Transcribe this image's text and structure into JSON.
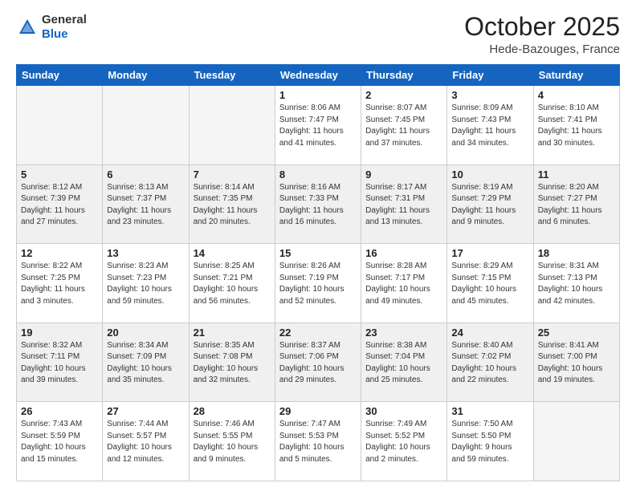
{
  "header": {
    "logo_line1": "General",
    "logo_line2": "Blue",
    "month": "October 2025",
    "location": "Hede-Bazouges, France"
  },
  "days_of_week": [
    "Sunday",
    "Monday",
    "Tuesday",
    "Wednesday",
    "Thursday",
    "Friday",
    "Saturday"
  ],
  "weeks": [
    {
      "shaded": false,
      "days": [
        {
          "num": "",
          "info": ""
        },
        {
          "num": "",
          "info": ""
        },
        {
          "num": "",
          "info": ""
        },
        {
          "num": "1",
          "info": "Sunrise: 8:06 AM\nSunset: 7:47 PM\nDaylight: 11 hours\nand 41 minutes."
        },
        {
          "num": "2",
          "info": "Sunrise: 8:07 AM\nSunset: 7:45 PM\nDaylight: 11 hours\nand 37 minutes."
        },
        {
          "num": "3",
          "info": "Sunrise: 8:09 AM\nSunset: 7:43 PM\nDaylight: 11 hours\nand 34 minutes."
        },
        {
          "num": "4",
          "info": "Sunrise: 8:10 AM\nSunset: 7:41 PM\nDaylight: 11 hours\nand 30 minutes."
        }
      ]
    },
    {
      "shaded": true,
      "days": [
        {
          "num": "5",
          "info": "Sunrise: 8:12 AM\nSunset: 7:39 PM\nDaylight: 11 hours\nand 27 minutes."
        },
        {
          "num": "6",
          "info": "Sunrise: 8:13 AM\nSunset: 7:37 PM\nDaylight: 11 hours\nand 23 minutes."
        },
        {
          "num": "7",
          "info": "Sunrise: 8:14 AM\nSunset: 7:35 PM\nDaylight: 11 hours\nand 20 minutes."
        },
        {
          "num": "8",
          "info": "Sunrise: 8:16 AM\nSunset: 7:33 PM\nDaylight: 11 hours\nand 16 minutes."
        },
        {
          "num": "9",
          "info": "Sunrise: 8:17 AM\nSunset: 7:31 PM\nDaylight: 11 hours\nand 13 minutes."
        },
        {
          "num": "10",
          "info": "Sunrise: 8:19 AM\nSunset: 7:29 PM\nDaylight: 11 hours\nand 9 minutes."
        },
        {
          "num": "11",
          "info": "Sunrise: 8:20 AM\nSunset: 7:27 PM\nDaylight: 11 hours\nand 6 minutes."
        }
      ]
    },
    {
      "shaded": false,
      "days": [
        {
          "num": "12",
          "info": "Sunrise: 8:22 AM\nSunset: 7:25 PM\nDaylight: 11 hours\nand 3 minutes."
        },
        {
          "num": "13",
          "info": "Sunrise: 8:23 AM\nSunset: 7:23 PM\nDaylight: 10 hours\nand 59 minutes."
        },
        {
          "num": "14",
          "info": "Sunrise: 8:25 AM\nSunset: 7:21 PM\nDaylight: 10 hours\nand 56 minutes."
        },
        {
          "num": "15",
          "info": "Sunrise: 8:26 AM\nSunset: 7:19 PM\nDaylight: 10 hours\nand 52 minutes."
        },
        {
          "num": "16",
          "info": "Sunrise: 8:28 AM\nSunset: 7:17 PM\nDaylight: 10 hours\nand 49 minutes."
        },
        {
          "num": "17",
          "info": "Sunrise: 8:29 AM\nSunset: 7:15 PM\nDaylight: 10 hours\nand 45 minutes."
        },
        {
          "num": "18",
          "info": "Sunrise: 8:31 AM\nSunset: 7:13 PM\nDaylight: 10 hours\nand 42 minutes."
        }
      ]
    },
    {
      "shaded": true,
      "days": [
        {
          "num": "19",
          "info": "Sunrise: 8:32 AM\nSunset: 7:11 PM\nDaylight: 10 hours\nand 39 minutes."
        },
        {
          "num": "20",
          "info": "Sunrise: 8:34 AM\nSunset: 7:09 PM\nDaylight: 10 hours\nand 35 minutes."
        },
        {
          "num": "21",
          "info": "Sunrise: 8:35 AM\nSunset: 7:08 PM\nDaylight: 10 hours\nand 32 minutes."
        },
        {
          "num": "22",
          "info": "Sunrise: 8:37 AM\nSunset: 7:06 PM\nDaylight: 10 hours\nand 29 minutes."
        },
        {
          "num": "23",
          "info": "Sunrise: 8:38 AM\nSunset: 7:04 PM\nDaylight: 10 hours\nand 25 minutes."
        },
        {
          "num": "24",
          "info": "Sunrise: 8:40 AM\nSunset: 7:02 PM\nDaylight: 10 hours\nand 22 minutes."
        },
        {
          "num": "25",
          "info": "Sunrise: 8:41 AM\nSunset: 7:00 PM\nDaylight: 10 hours\nand 19 minutes."
        }
      ]
    },
    {
      "shaded": false,
      "days": [
        {
          "num": "26",
          "info": "Sunrise: 7:43 AM\nSunset: 5:59 PM\nDaylight: 10 hours\nand 15 minutes."
        },
        {
          "num": "27",
          "info": "Sunrise: 7:44 AM\nSunset: 5:57 PM\nDaylight: 10 hours\nand 12 minutes."
        },
        {
          "num": "28",
          "info": "Sunrise: 7:46 AM\nSunset: 5:55 PM\nDaylight: 10 hours\nand 9 minutes."
        },
        {
          "num": "29",
          "info": "Sunrise: 7:47 AM\nSunset: 5:53 PM\nDaylight: 10 hours\nand 5 minutes."
        },
        {
          "num": "30",
          "info": "Sunrise: 7:49 AM\nSunset: 5:52 PM\nDaylight: 10 hours\nand 2 minutes."
        },
        {
          "num": "31",
          "info": "Sunrise: 7:50 AM\nSunset: 5:50 PM\nDaylight: 9 hours\nand 59 minutes."
        },
        {
          "num": "",
          "info": ""
        }
      ]
    }
  ]
}
